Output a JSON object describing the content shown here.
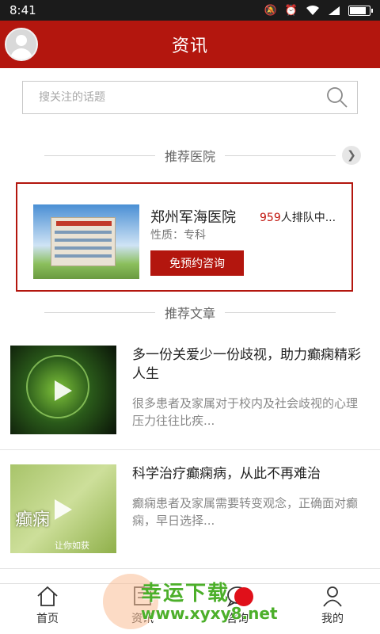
{
  "status_bar": {
    "time": "8:41",
    "battery_level": 0.85
  },
  "header": {
    "title": "资讯"
  },
  "search": {
    "placeholder": "搜关注的话题"
  },
  "hospitals_section": {
    "title": "推荐医院",
    "hospital": {
      "name": "郑州军海医院",
      "queue_count": "959",
      "queue_suffix": "人排队中...",
      "type_label": "性质：专科",
      "consult_button": "免预约咨询"
    }
  },
  "articles_section": {
    "title": "推荐文章",
    "articles": [
      {
        "title": "多一份关爱少一份歧视，助力癫痫精彩人生",
        "summary": "很多患者及家属对于校内及社会歧视的心理压力往往比疾...",
        "thumb_text": "",
        "thumb_sub": ""
      },
      {
        "title": "科学治疗癫痫病，从此不再难治",
        "summary": "癫痫患者及家属需要转变观念，正确面对癫痫，早日选择...",
        "thumb_text": "癫痫",
        "thumb_sub": "让你如获"
      }
    ]
  },
  "tab_bar": {
    "tabs": [
      {
        "label": "首页",
        "icon": "home-icon"
      },
      {
        "label": "资讯",
        "icon": "news-icon"
      },
      {
        "label": "咨询",
        "icon": "consult-icon"
      },
      {
        "label": "我的",
        "icon": "profile-icon"
      }
    ]
  },
  "watermark": {
    "text": "幸运下载",
    "url": "www.xyxy8.net"
  },
  "colors": {
    "brand": "#b3160e",
    "badge": "#e0101a"
  }
}
